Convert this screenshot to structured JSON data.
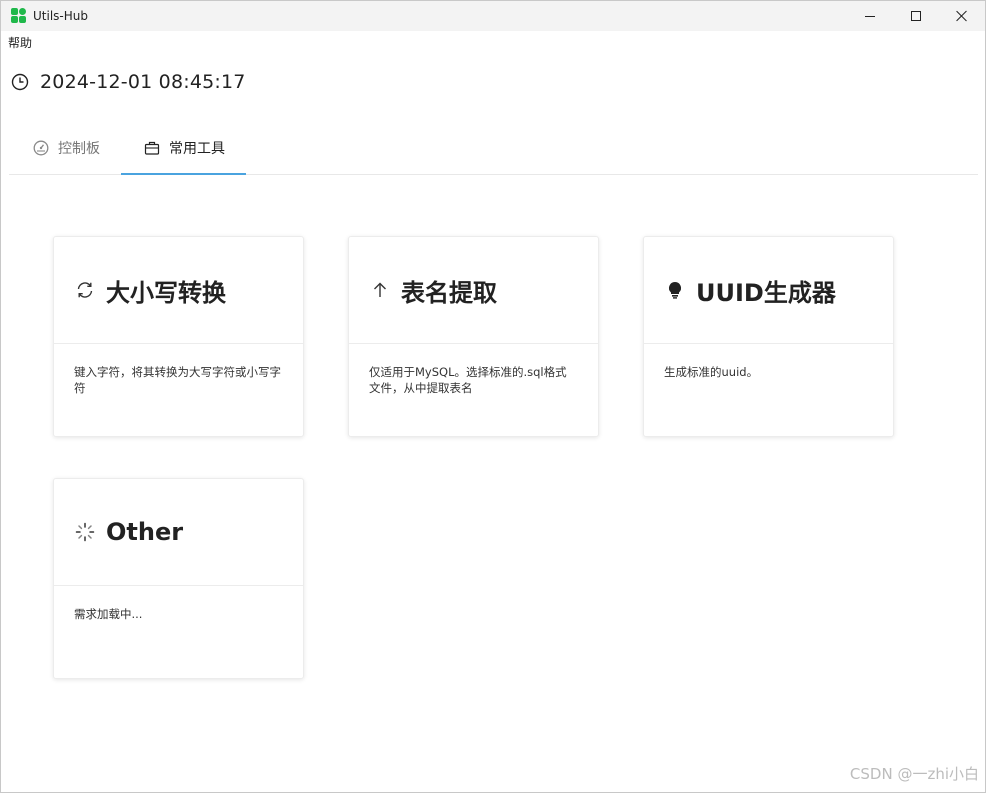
{
  "window": {
    "title": "Utils-Hub",
    "controls": [
      "minimize-icon",
      "maximize-icon",
      "close-icon"
    ]
  },
  "menu": {
    "items": [
      {
        "label": "帮助"
      }
    ]
  },
  "clock": {
    "icon": "clock-icon",
    "datetime": "2024-12-01 08:45:17"
  },
  "tabs": [
    {
      "label": "控制板",
      "icon": "dashboard-icon",
      "active": false
    },
    {
      "label": "常用工具",
      "icon": "briefcase-icon",
      "active": true
    }
  ],
  "cards": [
    {
      "title": "大小写转换",
      "icon": "sync-icon",
      "description": "键入字符，将其转换为大写字符或小写字符"
    },
    {
      "title": "表名提取",
      "icon": "arrow-up-icon",
      "description": "仅适用于MySQL。选择标准的.sql格式文件，从中提取表名"
    },
    {
      "title": "UUID生成器",
      "icon": "bulb-icon",
      "description": "生成标准的uuid。"
    },
    {
      "title": "Other",
      "icon": "loading-icon",
      "description": "需求加载中..."
    }
  ],
  "watermark": "CSDN @一zhi小白",
  "colors": {
    "accent": "#4aa3df",
    "logo": "#1fb84a"
  }
}
